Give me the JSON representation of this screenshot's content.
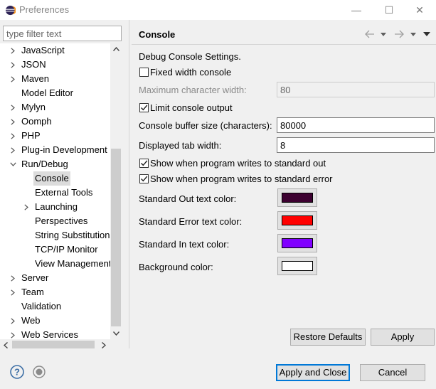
{
  "window": {
    "title": "Preferences",
    "minimize": "—",
    "maximize": "☐",
    "close": "✕"
  },
  "filter": {
    "placeholder": "type filter text"
  },
  "tree": {
    "items": [
      {
        "label": "JavaScript",
        "level": 0,
        "twisty": "collapsed"
      },
      {
        "label": "JSON",
        "level": 0,
        "twisty": "collapsed"
      },
      {
        "label": "Maven",
        "level": 0,
        "twisty": "collapsed"
      },
      {
        "label": "Model Editor",
        "level": 0,
        "twisty": "none"
      },
      {
        "label": "Mylyn",
        "level": 0,
        "twisty": "collapsed"
      },
      {
        "label": "Oomph",
        "level": 0,
        "twisty": "collapsed"
      },
      {
        "label": "PHP",
        "level": 0,
        "twisty": "collapsed"
      },
      {
        "label": "Plug-in Development",
        "level": 0,
        "twisty": "collapsed"
      },
      {
        "label": "Run/Debug",
        "level": 0,
        "twisty": "expanded"
      },
      {
        "label": "Console",
        "level": 1,
        "twisty": "none",
        "selected": true
      },
      {
        "label": "External Tools",
        "level": 1,
        "twisty": "none"
      },
      {
        "label": "Launching",
        "level": 1,
        "twisty": "collapsed"
      },
      {
        "label": "Perspectives",
        "level": 1,
        "twisty": "none"
      },
      {
        "label": "String Substitution",
        "level": 1,
        "twisty": "none"
      },
      {
        "label": "TCP/IP Monitor",
        "level": 1,
        "twisty": "none"
      },
      {
        "label": "View Management",
        "level": 1,
        "twisty": "none"
      },
      {
        "label": "Server",
        "level": 0,
        "twisty": "collapsed"
      },
      {
        "label": "Team",
        "level": 0,
        "twisty": "collapsed"
      },
      {
        "label": "Validation",
        "level": 0,
        "twisty": "none"
      },
      {
        "label": "Web",
        "level": 0,
        "twisty": "collapsed"
      },
      {
        "label": "Web Services",
        "level": 0,
        "twisty": "collapsed"
      }
    ]
  },
  "page": {
    "title": "Console",
    "description": "Debug Console Settings.",
    "fixed_width": {
      "label": "Fixed width console",
      "checked": false
    },
    "max_char_width": {
      "label": "Maximum character width:",
      "value": "80"
    },
    "limit_output": {
      "label": "Limit console output",
      "checked": true
    },
    "buffer_size": {
      "label": "Console buffer size (characters):",
      "value": "80000"
    },
    "tab_width": {
      "label": "Displayed tab width:",
      "value": "8"
    },
    "show_stdout": {
      "label": "Show when program writes to standard out",
      "checked": true
    },
    "show_stderr": {
      "label": "Show when program writes to standard error",
      "checked": true
    },
    "colors": [
      {
        "label": "Standard Out text color:",
        "color": "#3c0030"
      },
      {
        "label": "Standard Error text color:",
        "color": "#ff0000"
      },
      {
        "label": "Standard In text color:",
        "color": "#8000ff"
      },
      {
        "label": "Background color:",
        "color": "#ffffff"
      }
    ],
    "restore_defaults": "Restore Defaults",
    "apply": "Apply"
  },
  "footer": {
    "apply_and_close": "Apply and Close",
    "cancel": "Cancel"
  },
  "theme": {
    "selection": "#dcdcdc",
    "default_button_border": "#0078d7",
    "help_icon_color": "#3c6ea5"
  },
  "icons": {
    "app": "eclipse-icon",
    "help": "help-icon",
    "record": "record-icon",
    "back": "back-arrow-icon",
    "forward": "forward-arrow-icon",
    "menu": "view-menu-icon"
  }
}
